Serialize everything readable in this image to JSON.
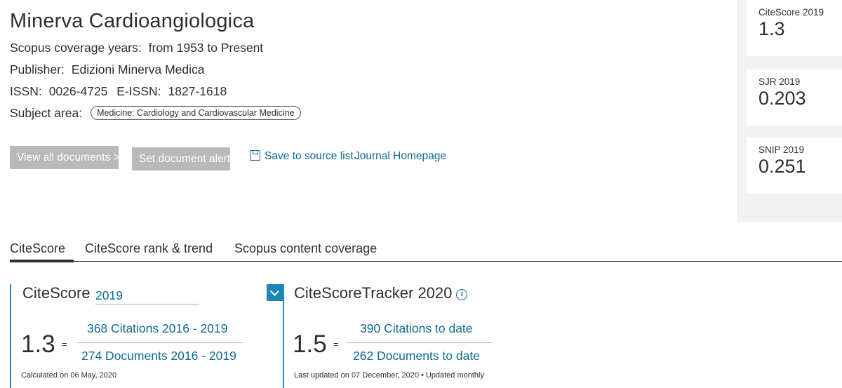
{
  "source": {
    "title": "Minerva Cardioangiologica",
    "coverage_label": "Scopus coverage years:",
    "coverage_value": "from 1953 to Present",
    "publisher_label": "Publisher:",
    "publisher_value": "Edizioni Minerva Medica",
    "issn_label": "ISSN:",
    "issn_value": "0026-4725",
    "eissn_label": "E-ISSN:",
    "eissn_value": "1827-1618",
    "subject_label": "Subject area:",
    "subject_chip": "Medicine: Cardiology and Cardiovascular Medicine"
  },
  "actions": {
    "view_all": "View all documents >",
    "set_alert": "Set document alert",
    "save_to_list": "Save to source list",
    "journal_homepage": "Journal Homepage"
  },
  "metrics": [
    {
      "label": "CiteScore 2019",
      "value": "1.3"
    },
    {
      "label": "SJR 2019",
      "value": "0.203"
    },
    {
      "label": "SNIP 2019",
      "value": "0.251"
    }
  ],
  "tabs": [
    "CiteScore",
    "CiteScore rank & trend",
    "Scopus content coverage"
  ],
  "citescore": {
    "title": "CiteScore",
    "year": "2019",
    "value": "1.3",
    "equals": "=",
    "numerator": "368 Citations 2016 - 2019",
    "denominator": "274 Documents 2016 - 2019",
    "note": "Calculated on 06 May, 2020"
  },
  "tracker": {
    "title": "CiteScoreTracker 2020",
    "value": "1.5",
    "equals": "=",
    "numerator": "390 Citations to date",
    "denominator": "262 Documents to date",
    "note_date": "Last updated on 07 December, 2020",
    "note_bullet": "•",
    "note_freq": "Updated monthly"
  },
  "colors": {
    "link": "#0e6a93",
    "accent": "#1f86b5",
    "button_disabled": "#b9b9b9",
    "sidebar_bg": "#f2f2f2"
  }
}
